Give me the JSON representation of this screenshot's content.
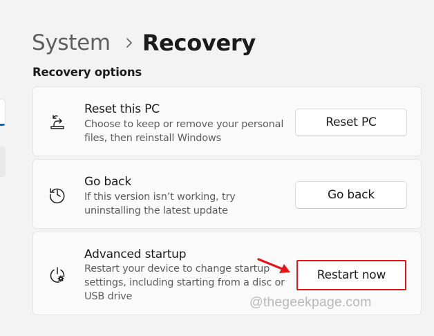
{
  "breadcrumb": {
    "parent": "System",
    "current": "Recovery"
  },
  "section": {
    "title": "Recovery options"
  },
  "cards": [
    {
      "title": "Reset this PC",
      "description": "Choose to keep or remove your personal files, then reinstall Windows",
      "button": "Reset PC",
      "icon": "reset-pc-icon"
    },
    {
      "title": "Go back",
      "description": "If this version isn’t working, try uninstalling the latest update",
      "button": "Go back",
      "icon": "history-icon"
    },
    {
      "title": "Advanced startup",
      "description": "Restart your device to change startup settings, including starting from a disc or USB drive",
      "button": "Restart now",
      "icon": "advanced-startup-icon"
    }
  ],
  "annotation": {
    "highlight_color": "#e3141b",
    "arrow_color": "#e3141b"
  },
  "watermark": "@thegeekpage.com",
  "colors": {
    "accent": "#0067c0",
    "background": "#f3f3f3",
    "card": "#fbfbfb"
  }
}
